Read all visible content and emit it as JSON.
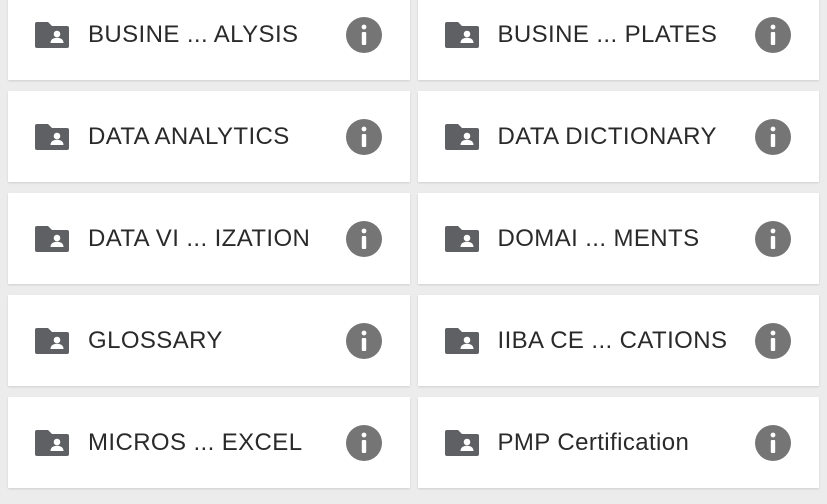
{
  "colors": {
    "background": "#ececec",
    "card": "#ffffff",
    "icon": "#5f6064",
    "info": "#757575",
    "text": "#2a2a2a"
  },
  "folders": [
    {
      "label": "BUSINE ... ALYSIS",
      "icon": "shared-folder-icon"
    },
    {
      "label": "BUSINE ... PLATES",
      "icon": "shared-folder-icon"
    },
    {
      "label": "DATA ANALYTICS",
      "icon": "shared-folder-icon"
    },
    {
      "label": "DATA DICTIONARY",
      "icon": "shared-folder-icon"
    },
    {
      "label": "DATA VI ... IZATION",
      "icon": "shared-folder-icon"
    },
    {
      "label": "DOMAI ... MENTS",
      "icon": "shared-folder-icon"
    },
    {
      "label": "GLOSSARY",
      "icon": "shared-folder-icon"
    },
    {
      "label": "IIBA CE ... CATIONS",
      "icon": "shared-folder-icon"
    },
    {
      "label": "MICROS ... EXCEL",
      "icon": "shared-folder-icon"
    },
    {
      "label": "PMP Certification",
      "icon": "shared-folder-icon"
    }
  ]
}
